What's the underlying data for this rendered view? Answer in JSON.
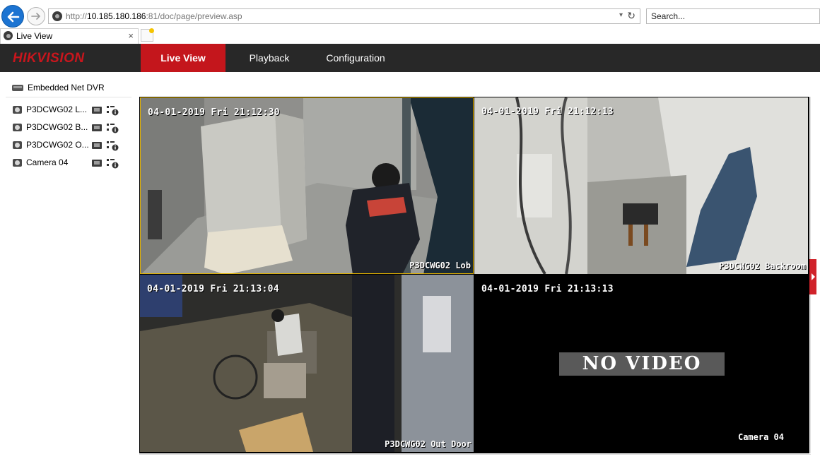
{
  "browser": {
    "url_prefix": "http://",
    "url_host": "10.185.180.186",
    "url_rest": ":81/doc/page/preview.asp",
    "search_placeholder": "Search...",
    "tab_title": "Live View",
    "tab_close": "×"
  },
  "app": {
    "logo": "HIKVISION",
    "menu": [
      {
        "label": "Live View",
        "active": true
      },
      {
        "label": "Playback",
        "active": false
      },
      {
        "label": "Configuration",
        "active": false
      }
    ]
  },
  "sidebar": {
    "root_label": "Embedded Net DVR",
    "cameras": [
      {
        "label": "P3DCWG02 L..."
      },
      {
        "label": "P3DCWG02 B..."
      },
      {
        "label": "P3DCWG02 O..."
      },
      {
        "label": "Camera 04"
      }
    ]
  },
  "views": [
    {
      "timestamp": "04-01-2019 Fri 21:12:30",
      "name": "P3DCWG02 Lob",
      "selected": true
    },
    {
      "timestamp": "04-01-2019 Fri 21:12:13",
      "name": "P3DCWG02 Backroom",
      "selected": false
    },
    {
      "timestamp": "04-01-2019 Fri 21:13:04",
      "name": "P3DCWG02 Out Door",
      "selected": false
    },
    {
      "timestamp": "04-01-2019 Fri 21:13:13",
      "name": "Camera 04",
      "no_video": "NO VIDEO",
      "selected": false
    }
  ],
  "colors": {
    "accent": "#c4161c",
    "header_bg": "#282828",
    "selected_border": "#e2b200"
  }
}
